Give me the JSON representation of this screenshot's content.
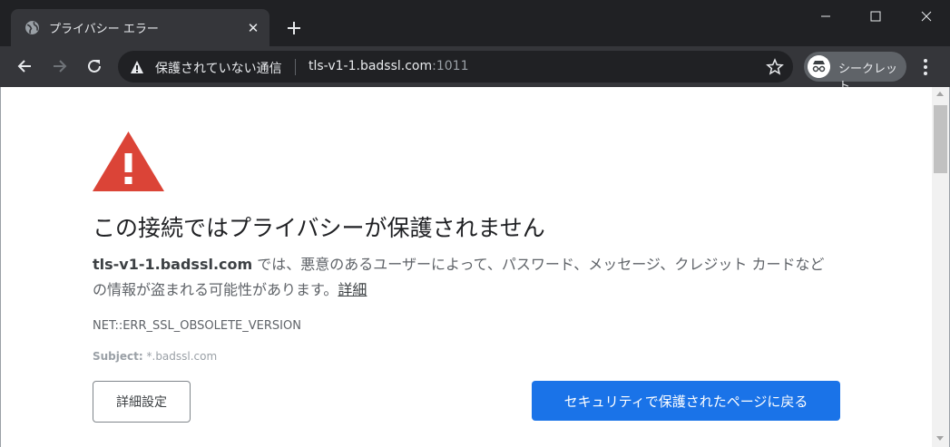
{
  "tab": {
    "title": "プライバシー エラー",
    "close": "✕",
    "new_tab": "+"
  },
  "toolbar": {
    "security_label": "保護されていない通信",
    "url_host": "tls-v1-1.badssl.com",
    "url_port": ":1011",
    "incognito_label": "シークレット"
  },
  "page": {
    "heading": "この接続ではプライバシーが保護されません",
    "desc_host": "tls-v1-1.badssl.com",
    "desc_text": " では、悪意のあるユーザーによって、パスワード、メッセージ、クレジット カードなどの情報が盗まれる可能性があります。",
    "details_link": "詳細",
    "error_code": "NET::ERR_SSL_OBSOLETE_VERSION",
    "subject_label": "Subject:",
    "subject_value": " *.badssl.com",
    "advanced_button": "詳細設定",
    "back_button": "セキュリティで保護されたページに戻る"
  },
  "colors": {
    "warning_red": "#db4437",
    "primary_blue": "#1a73e8"
  },
  "icons": [
    "globe-icon",
    "close-icon",
    "plus-icon",
    "minimize-icon",
    "maximize-icon",
    "window-close-icon",
    "back-arrow-icon",
    "forward-arrow-icon",
    "reload-icon",
    "warning-triangle-icon",
    "star-icon",
    "incognito-icon",
    "more-vert-icon"
  ]
}
